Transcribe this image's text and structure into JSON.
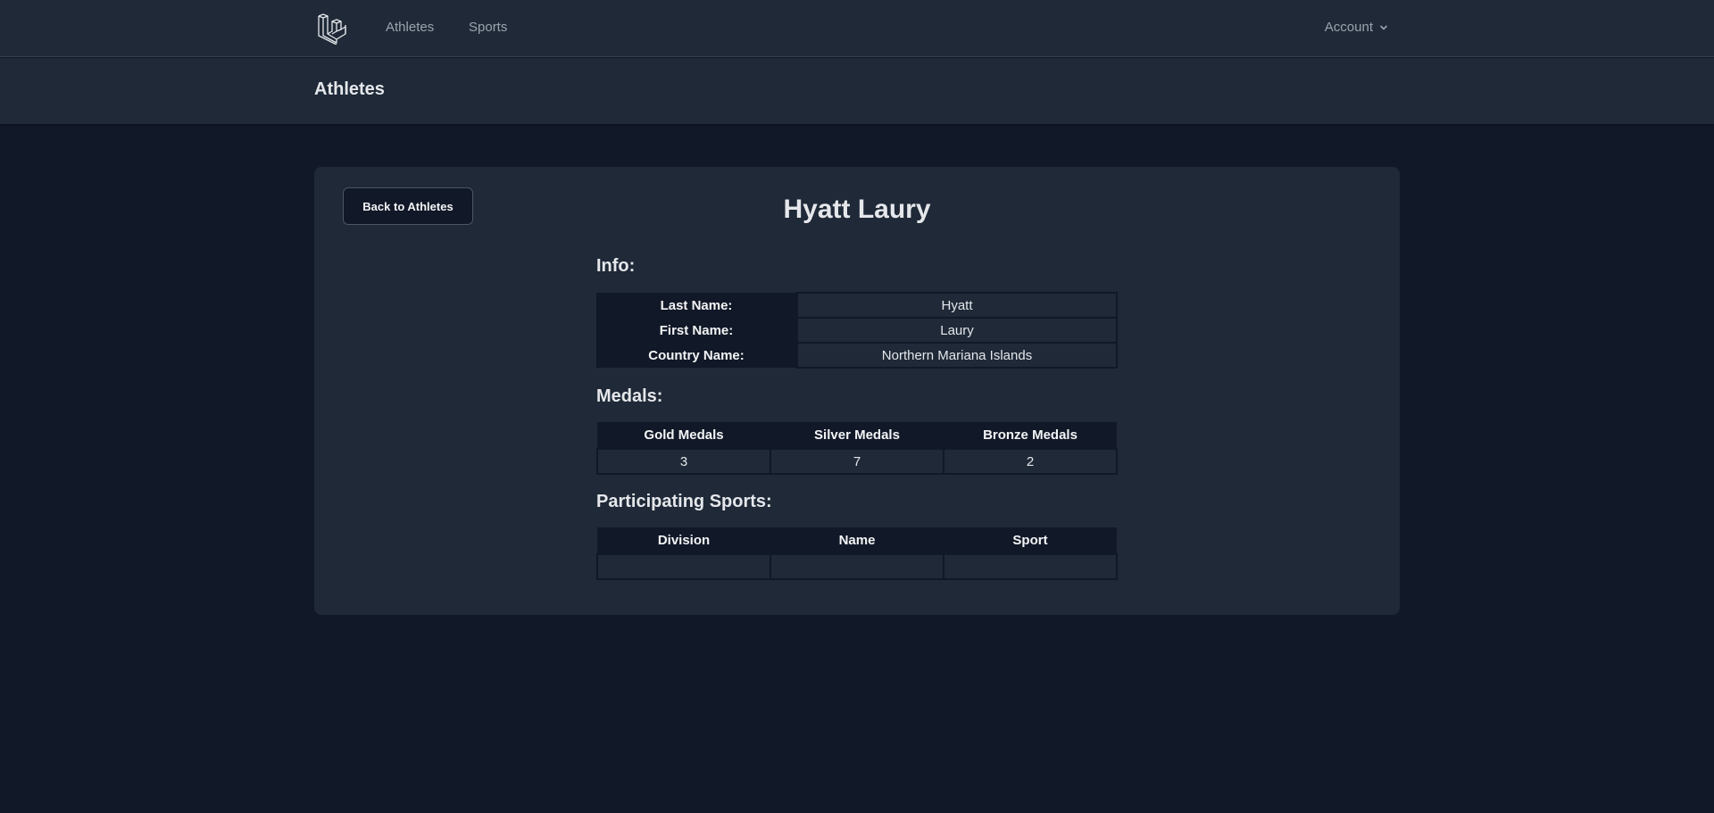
{
  "nav": {
    "logo_icon": "laravel-logo-icon",
    "links": [
      "Athletes",
      "Sports"
    ],
    "account_label": "Account"
  },
  "header": {
    "title": "Athletes"
  },
  "card": {
    "back_button": "Back to Athletes",
    "athlete_name": "Hyatt Laury",
    "info": {
      "heading": "Info:",
      "rows": [
        {
          "label": "Last Name:",
          "value": "Hyatt"
        },
        {
          "label": "First Name:",
          "value": "Laury"
        },
        {
          "label": "Country Name:",
          "value": "Northern Mariana Islands"
        }
      ]
    },
    "medals": {
      "heading": "Medals:",
      "columns": [
        "Gold Medals",
        "Silver Medals",
        "Bronze Medals"
      ],
      "values": [
        "3",
        "7",
        "2"
      ]
    },
    "sports": {
      "heading": "Participating Sports:",
      "columns": [
        "Division",
        "Name",
        "Sport"
      ],
      "rows": [
        [
          "",
          "",
          ""
        ]
      ]
    }
  },
  "colors": {
    "page_bg": "#111827",
    "surface": "#1f2937",
    "text": "#e5e7eb",
    "muted": "#9ca3af"
  }
}
